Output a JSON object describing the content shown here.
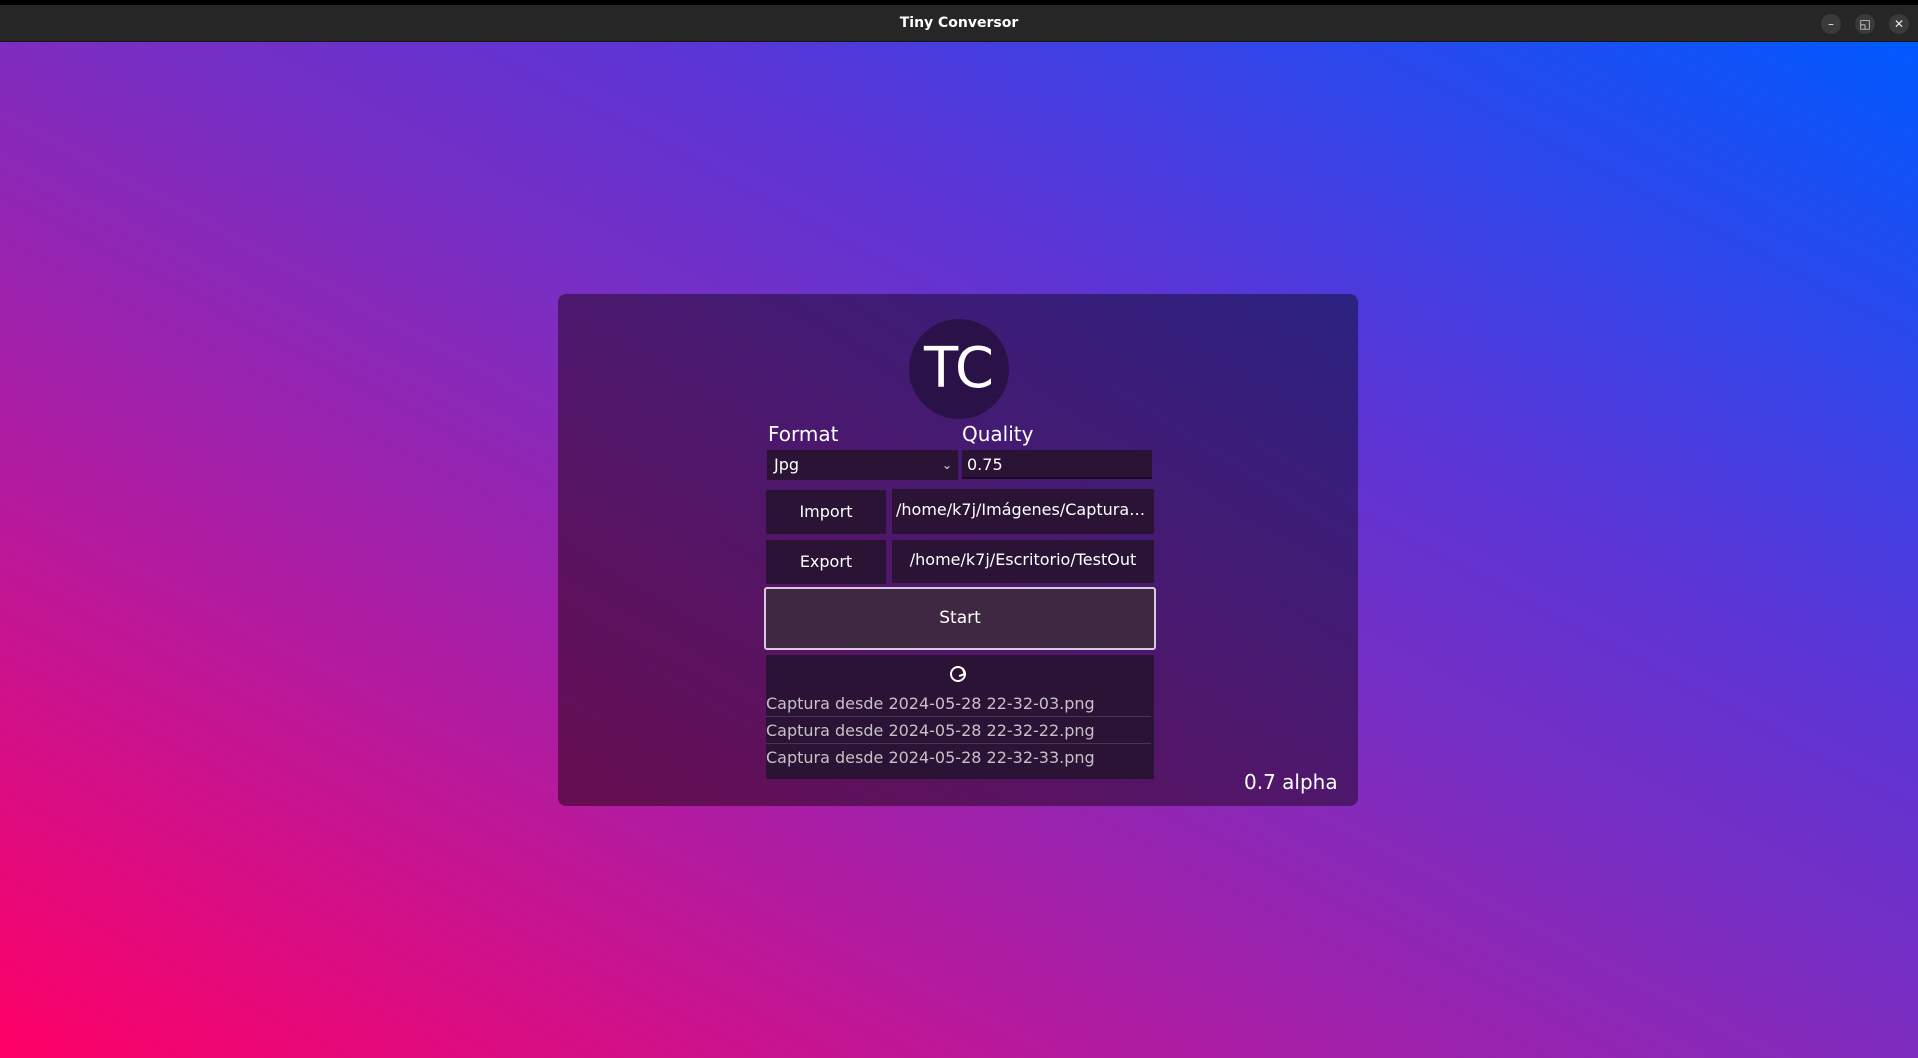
{
  "window": {
    "title": "Tiny Conversor",
    "minimize_glyph": "–",
    "maximize_glyph": "◱",
    "close_glyph": "✕"
  },
  "colors": {
    "gradient_start": "#ff0066",
    "gradient_end": "#0059ff",
    "panel": "#2b1335"
  },
  "logo": {
    "text": "TC"
  },
  "format": {
    "label": "Format",
    "selected": "Jpg"
  },
  "quality": {
    "label": "Quality",
    "value": "0.75"
  },
  "import": {
    "button_label": "Import",
    "path": "/home/k7j/Imágenes/Capturas ..."
  },
  "export": {
    "button_label": "Export",
    "path": "/home/k7j/Escritorio/TestOut"
  },
  "start": {
    "label": "Start"
  },
  "log": {
    "icon": "loading-spinner-icon",
    "items": [
      "Captura desde 2024-05-28 22-32-03.png",
      "Captura desde 2024-05-28 22-32-22.png",
      "Captura desde 2024-05-28 22-32-33.png"
    ]
  },
  "version": "0.7 alpha"
}
